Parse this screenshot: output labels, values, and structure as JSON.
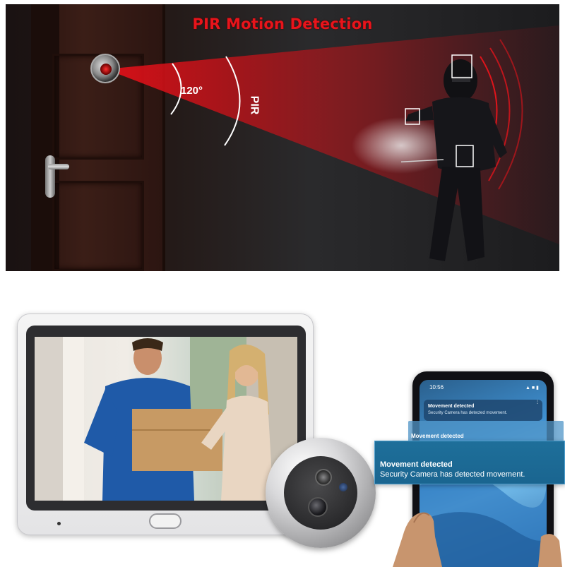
{
  "top_panel": {
    "title": "PIR Motion Detection",
    "angle_label": "120°",
    "pir_label": "PIR"
  },
  "phone": {
    "status_time": "10:56",
    "status_icons": "▲ ■ ▮",
    "card_title": "Movement detected",
    "card_body": "Security Camera has detected movement.",
    "ghost_card_text": "Movement detected"
  },
  "notification": {
    "title": "Movement detected",
    "body": "Security Camera has detected movement."
  },
  "colors": {
    "title_red": "#e8141b",
    "beam_red": "#c0141b",
    "notification_blue": "#1e6f9a"
  },
  "icons": {
    "peephole": "peephole-camera-icon",
    "intruder": "intruder-figure",
    "monitor": "indoor-monitor",
    "camera": "door-camera-unit",
    "phone": "smartphone",
    "hand": "hand"
  }
}
